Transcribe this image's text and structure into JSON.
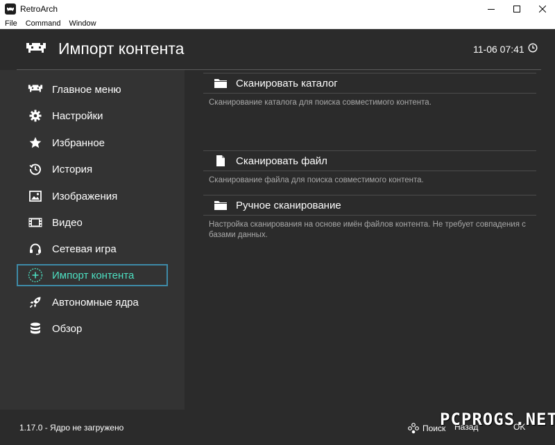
{
  "window": {
    "title": "RetroArch",
    "menu": [
      "File",
      "Command",
      "Window"
    ]
  },
  "header": {
    "title": "Импорт контента",
    "clock": "11-06 07:41"
  },
  "sidebar": {
    "items": [
      {
        "label": "Главное меню",
        "icon": "invader-icon"
      },
      {
        "label": "Настройки",
        "icon": "gear-icon"
      },
      {
        "label": "Избранное",
        "icon": "star-icon"
      },
      {
        "label": "История",
        "icon": "history-icon"
      },
      {
        "label": "Изображения",
        "icon": "image-icon"
      },
      {
        "label": "Видео",
        "icon": "film-icon"
      },
      {
        "label": "Сетевая игра",
        "icon": "headset-icon"
      },
      {
        "label": "Импорт контента",
        "icon": "plus-icon",
        "active": true
      },
      {
        "label": "Автономные ядра",
        "icon": "rocket-icon"
      },
      {
        "label": "Обзор",
        "icon": "database-icon"
      }
    ]
  },
  "content": {
    "entries": [
      {
        "label": "Сканировать каталог",
        "icon": "folder-icon",
        "desc": "Сканирование каталога для поиска совместимого контента."
      },
      {
        "label": "Сканировать файл",
        "icon": "file-icon",
        "desc": "Сканирование файла для поиска совместимого контента."
      },
      {
        "label": "Ручное сканирование",
        "icon": "folder-icon",
        "desc": "Настройка сканирования на основе имён файлов контента. Не требует совпадения с базами данных."
      }
    ]
  },
  "footer": {
    "status": "1.17.0 - Ядро не загружено",
    "hints": [
      "Поиск",
      "Назад",
      "OK"
    ]
  },
  "watermark": "PCPROGS.NET",
  "colors": {
    "accent": "#4de0c2",
    "active_border": "#3e8ba8",
    "background": "#2b2b2b",
    "sidebar": "#333333"
  }
}
